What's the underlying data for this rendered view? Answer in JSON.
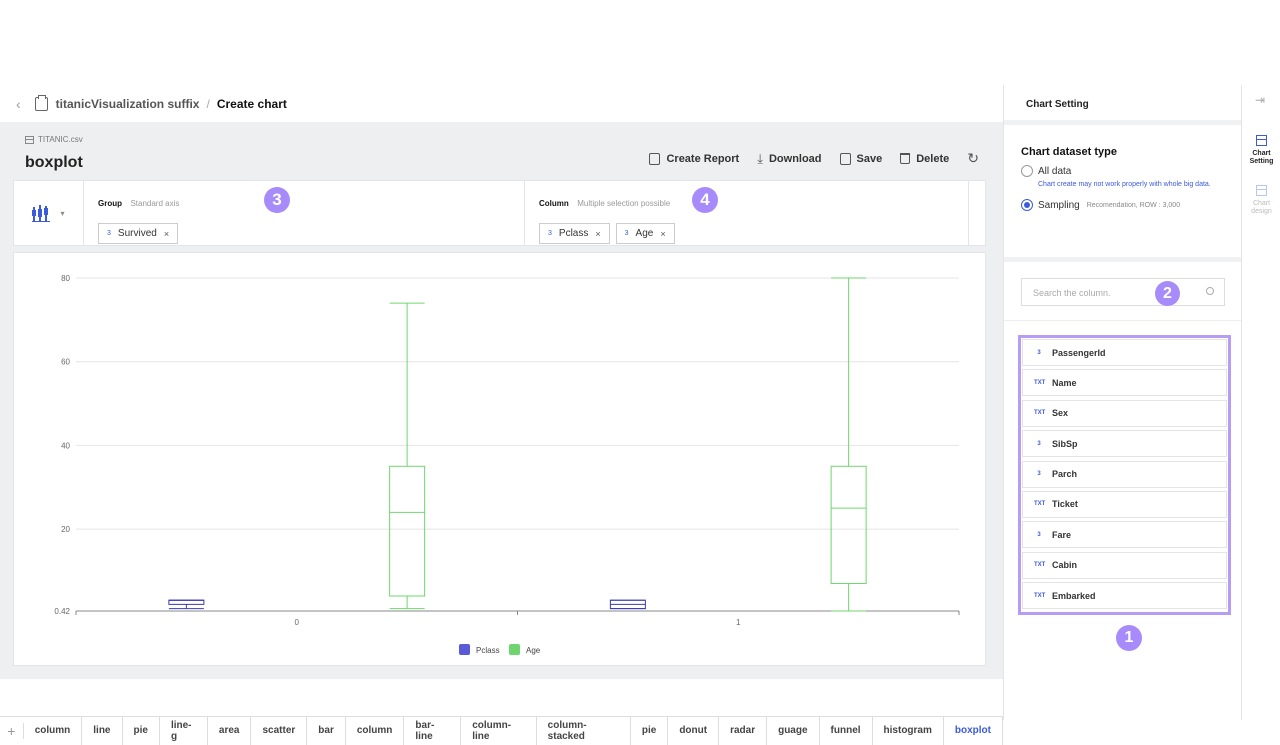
{
  "breadcrumb": {
    "project": "titanicVisualization suffix",
    "separator": "/",
    "page": "Create chart"
  },
  "file": {
    "name": "TITANIC.csv"
  },
  "chart_title": "boxplot",
  "actions": {
    "create_report": "Create Report",
    "download": "Download",
    "save": "Save",
    "delete": "Delete"
  },
  "axis": {
    "group": {
      "label": "Group",
      "hint": "Standard axis",
      "chips": [
        {
          "type": "3",
          "name": "Survived"
        }
      ]
    },
    "column": {
      "label": "Column",
      "hint": "Multiple selection possible",
      "chips": [
        {
          "type": "3",
          "name": "Pclass"
        },
        {
          "type": "3",
          "name": "Age"
        }
      ]
    }
  },
  "markers": {
    "m1": "1",
    "m2": "2",
    "m3": "3",
    "m4": "4"
  },
  "chart_data": {
    "type": "boxplot",
    "categories": [
      "0",
      "1"
    ],
    "yticks": [
      "0.42",
      "20",
      "40",
      "60",
      "80"
    ],
    "ylim": [
      0.42,
      80
    ],
    "series": [
      {
        "name": "Pclass",
        "color": "#3b3bb0",
        "legend_color": "#5a5ad6",
        "boxes": [
          {
            "min": 1,
            "q1": 2,
            "median": 3,
            "q3": 3,
            "max": 3
          },
          {
            "min": 1,
            "q1": 1,
            "median": 2,
            "q3": 3,
            "max": 3
          }
        ]
      },
      {
        "name": "Age",
        "color": "#6fd66f",
        "legend_color": "#6fd66f",
        "boxes": [
          {
            "min": 1,
            "q1": 4,
            "median": 24,
            "q3": 35,
            "max": 74
          },
          {
            "min": 0.42,
            "q1": 7,
            "median": 25,
            "q3": 35,
            "max": 80
          }
        ]
      }
    ]
  },
  "chart_tabs": [
    "column",
    "line",
    "pie",
    "line-g",
    "area",
    "scatter",
    "bar",
    "column",
    "bar-line",
    "column-line",
    "column-stacked",
    "pie",
    "donut",
    "radar",
    "guage",
    "funnel",
    "histogram",
    "boxplot"
  ],
  "active_tab": "boxplot",
  "settings": {
    "title": "Chart Setting",
    "dataset_title": "Chart dataset type",
    "option_all": "All data",
    "option_all_note": "Chart create may not work properly with whole big data.",
    "option_sampling": "Sampling",
    "option_sampling_note": "Recomendation, ROW : 3,000",
    "search_placeholder": "Search the column.",
    "columns": [
      {
        "type": "3",
        "name": "PassengerId"
      },
      {
        "type": "TXT",
        "name": "Name"
      },
      {
        "type": "TXT",
        "name": "Sex"
      },
      {
        "type": "3",
        "name": "SibSp"
      },
      {
        "type": "3",
        "name": "Parch"
      },
      {
        "type": "TXT",
        "name": "Ticket"
      },
      {
        "type": "3",
        "name": "Fare"
      },
      {
        "type": "TXT",
        "name": "Cabin"
      },
      {
        "type": "TXT",
        "name": "Embarked"
      }
    ]
  },
  "rail": {
    "chart_setting": "Chart Setting",
    "chart_design": "Chart design"
  }
}
